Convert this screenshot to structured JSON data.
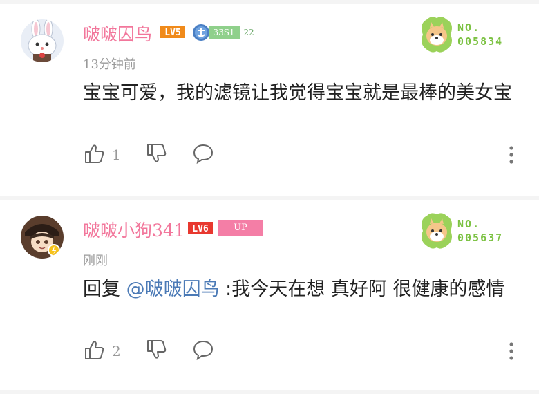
{
  "colors": {
    "username": "#f2769b",
    "mention": "#4b7ab6",
    "fan_green": "#7cc243",
    "up_badge": "#f47ea6"
  },
  "comments": [
    {
      "username": "啵啵囚鸟",
      "level": "LV5",
      "medal_name": "33S1",
      "medal_level": "22",
      "time": "13分钟前",
      "content": "宝宝可爱，我的滤镜让我觉得宝宝就是最棒的美女宝",
      "like_count": "1",
      "fan_label": "NO.",
      "fan_number": "005834",
      "avatar_icon": "bunny-avatar-icon"
    },
    {
      "username": "啵啵小狗341",
      "level": "LV6",
      "up_badge": "UP",
      "time": "刚刚",
      "reply_prefix": "回复 ",
      "mention": "@啵啵囚鸟",
      "content": " :我今天在想 真好阿 很健康的感情",
      "like_count": "2",
      "fan_label": "NO.",
      "fan_number": "005637",
      "avatar_icon": "anime-avatar-icon"
    }
  ]
}
